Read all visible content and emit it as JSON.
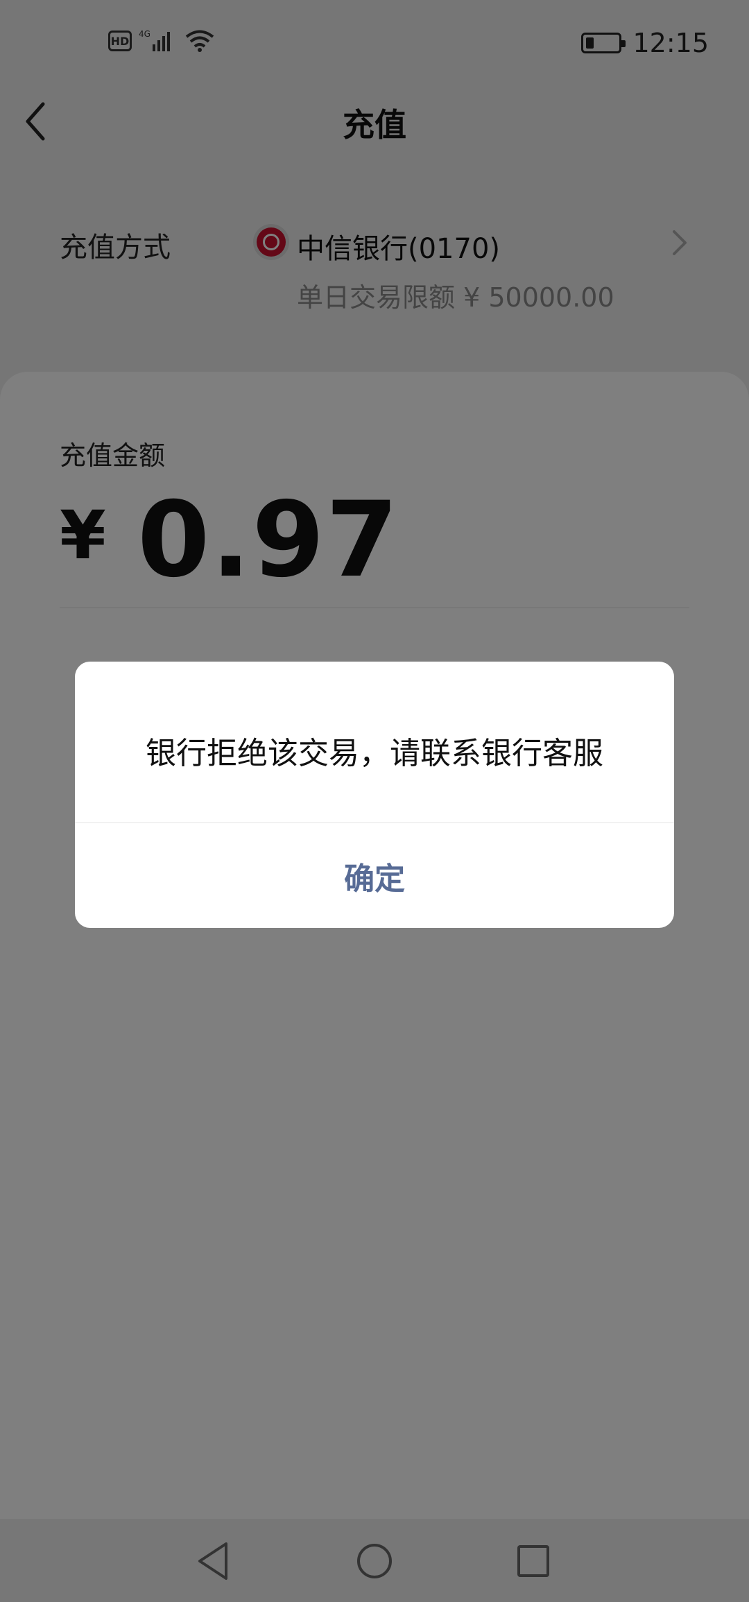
{
  "status_bar": {
    "hd_label": "HD",
    "network_label": "4G",
    "battery_level": 0.25,
    "time": "12:15"
  },
  "header": {
    "title": "充值",
    "back_icon": "chevron-left-icon"
  },
  "payment_method": {
    "label": "充值方式",
    "bank_icon": "citic-bank-logo",
    "bank_name": "中信银行(0170)",
    "limit_text": "单日交易限额 ¥ 50000.00",
    "chevron_icon": "chevron-right-icon"
  },
  "amount": {
    "label": "充值金额",
    "currency": "¥",
    "value": "0.97"
  },
  "dialog": {
    "message": "银行拒绝该交易，请联系银行客服",
    "confirm_label": "确定",
    "confirm_color": "#576b95"
  },
  "nav_bar": {
    "back_icon": "triangle-back-icon",
    "home_icon": "circle-home-icon",
    "recents_icon": "square-recents-icon"
  }
}
